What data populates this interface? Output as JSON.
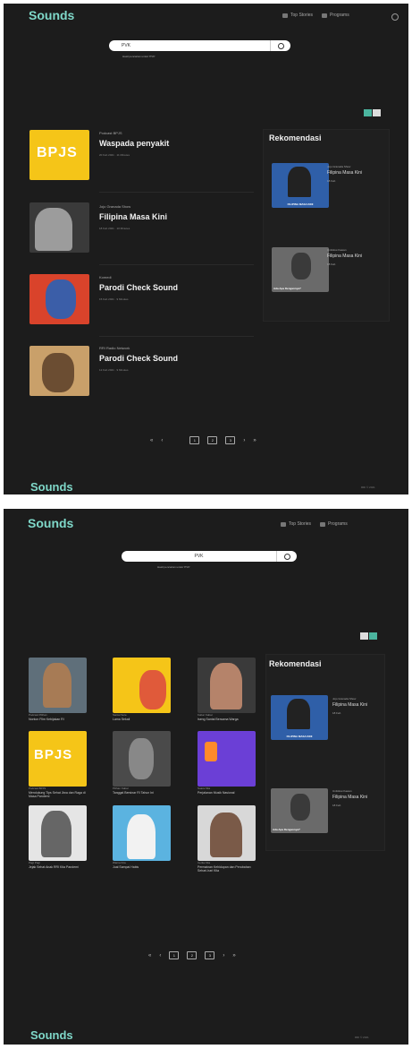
{
  "app": {
    "name": "Sounds"
  },
  "nav": {
    "top_stories": "Top Stories",
    "programs": "Programs"
  },
  "search": {
    "query": "PVK",
    "hint": "Hasil pencarian untuk 'PVK'"
  },
  "results": [
    {
      "program": "Podcast BPJS",
      "title": "Waspada penyakit",
      "meta": "20 Feb 2021 · 11 Minutes"
    },
    {
      "program": "Jojo Granada Show",
      "title": "Filipina Masa Kini",
      "meta": "18 Feb 2021 · 10 Minutes"
    },
    {
      "program": "Komedi",
      "title": "Parodi Check Sound",
      "meta": "15 Feb 2021 · 9 Minutes"
    },
    {
      "program": "RRI Radio Network",
      "title": "Parodi Check Sound",
      "meta": "12 Feb 2021 · 9 Minutes"
    }
  ],
  "reco": {
    "title": "Rekomendasi",
    "items": [
      {
        "program": "Jojo Granada Show",
        "name": "Filipina Masa Kini",
        "meta": "18 Feb",
        "thumb_caption": "FILIPINA MASA KINI"
      },
      {
        "program": "Unfollow Kawan",
        "name": "Filipina Masa Kini",
        "meta": "18 Feb",
        "thumb_caption": "Ada Apa Dengannya?"
      }
    ]
  },
  "grid": [
    {
      "meta": "Podcast Pilihan",
      "title": "Nonton Film Kebijakan RI"
    },
    {
      "meta": "Santai Sore",
      "title": "Lama Sekali"
    },
    {
      "meta": "Kabar Kabar",
      "title": "Iseng Santai Bersama Warga"
    },
    {
      "meta": "Podcast BPJS",
      "title": "Mendukung Tips Sehat Jiwa dan Raga di Masa Pandemi"
    },
    {
      "meta": "Pilihan Kabar",
      "title": "Tanggal Bersinar RI Tahun Ini"
    },
    {
      "meta": "Suara Kita",
      "title": "Perjalanan Musik Nasional"
    },
    {
      "meta": "Pagi Pagi",
      "title": "Jejak Sehat Anak RRI Kita Pandemi"
    },
    {
      "meta": "Warna Kita",
      "title": "Jual Sampai Habis"
    },
    {
      "meta": "Cerita Kita",
      "title": "Permainan Kehidupan dan Perubahan Sehari-hari Kita"
    }
  ],
  "pager": {
    "first": "«",
    "prev": "‹",
    "next": "›",
    "last": "»",
    "pages": [
      "1",
      "2",
      "3"
    ]
  },
  "footer": {
    "right": "RRI © 2021"
  },
  "bpjs": "BPJS",
  "colors": {
    "accent": "#7fd8c9",
    "background": "#1c1c1c",
    "bpjs_yellow": "#f5c518"
  }
}
